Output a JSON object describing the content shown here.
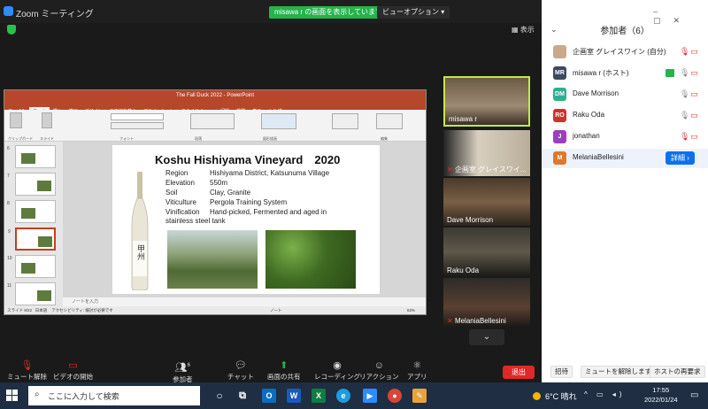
{
  "window": {
    "app_title": "Zoom ミーティング",
    "share_banner": "misawa r の画面を表示しています",
    "view_options": "ビューオプション ▾",
    "view_button": "表示"
  },
  "powerpoint": {
    "window_title": "The Fall Duck 2022 - PowerPoint",
    "tabs": [
      "ファイル",
      "ホーム",
      "挿入",
      "描画",
      "デザイン",
      "画面切り替え",
      "アニメーション",
      "スライド ショー",
      "記録",
      "校閲",
      "表示",
      "ヘルプ"
    ],
    "active_tab": "ホーム",
    "ribbon_groups": [
      "クリップボード",
      "スライド",
      "フォント",
      "段落",
      "図形描画",
      "編集"
    ],
    "slide_numbers": [
      "6",
      "7",
      "8",
      "9",
      "10",
      "11"
    ],
    "active_slide": "9",
    "notes_placeholder": "ノートを入力",
    "status_left": "スライド 9/22",
    "status_lang": "日本語",
    "status_accessibility": "アクセシビリティ: 検討が必要です",
    "status_notes": "ノート",
    "status_zoom": "63%"
  },
  "slide": {
    "title": "Koshu Hishiyama Vineyard　2020",
    "rows": [
      {
        "key": "Region",
        "value": "Hishiyama District, Katsunuma Village"
      },
      {
        "key": "Elevation",
        "value": "550m"
      },
      {
        "key": "Soil",
        "value": "Clay, Granite"
      },
      {
        "key": "Viticulture",
        "value": "Pergola Training System"
      },
      {
        "key": "Vinification",
        "value": "Hand-picked, Fermented and aged in"
      }
    ],
    "vinification_cont": "stainless steel tank",
    "bottle_label": "甲州"
  },
  "video_tiles": [
    {
      "name": "misawa r"
    },
    {
      "name": "企画室 グレイスワイ..."
    },
    {
      "name": "Dave Morrison"
    },
    {
      "name": "Raku Oda"
    },
    {
      "name": "MelaniaBellesini"
    }
  ],
  "more_tiles_icon": "chevron-down",
  "participants": {
    "title": "参加者（6）",
    "list": [
      {
        "initials": "",
        "name": "企画室 グレイスワイン (自分)",
        "color": "#c9a98a"
      },
      {
        "initials": "MR",
        "name": "misawa r (ホスト)",
        "color": "#3b4a60"
      },
      {
        "initials": "DM",
        "name": "Dave Morrison",
        "color": "#2db08f"
      },
      {
        "initials": "RO",
        "name": "Raku Oda",
        "color": "#d0312d"
      },
      {
        "initials": "J",
        "name": "jonathan",
        "color": "#9b3fbf"
      },
      {
        "initials": "M",
        "name": "MelaniaBellesini",
        "color": "#e0782b"
      }
    ],
    "detail_button": "詳細 ›",
    "footer": {
      "invite": "招待",
      "unmute_all": "ミュートを解除します",
      "request_unmute": "ホストの再要求"
    }
  },
  "toolbar": {
    "mute": "ミュート解除",
    "video": "ビデオの開始",
    "participants": "参加者",
    "participants_count": "6",
    "chat": "チャット",
    "share": "画面の共有",
    "record": "レコーディング",
    "reactions": "リアクション",
    "apps": "アプリ",
    "leave": "退出"
  },
  "taskbar": {
    "search_placeholder": "ここに入力して検索",
    "weather": "6°C 晴れ",
    "time": "17:55",
    "date": "2022/01/24",
    "colors": {
      "outlook": "#0f6cbd",
      "word": "#185abd",
      "excel": "#107c41",
      "edge": "#1b9de2",
      "zoom": "#2d8cff",
      "chrome": "#db4437",
      "paint": "#e8a33d"
    }
  }
}
